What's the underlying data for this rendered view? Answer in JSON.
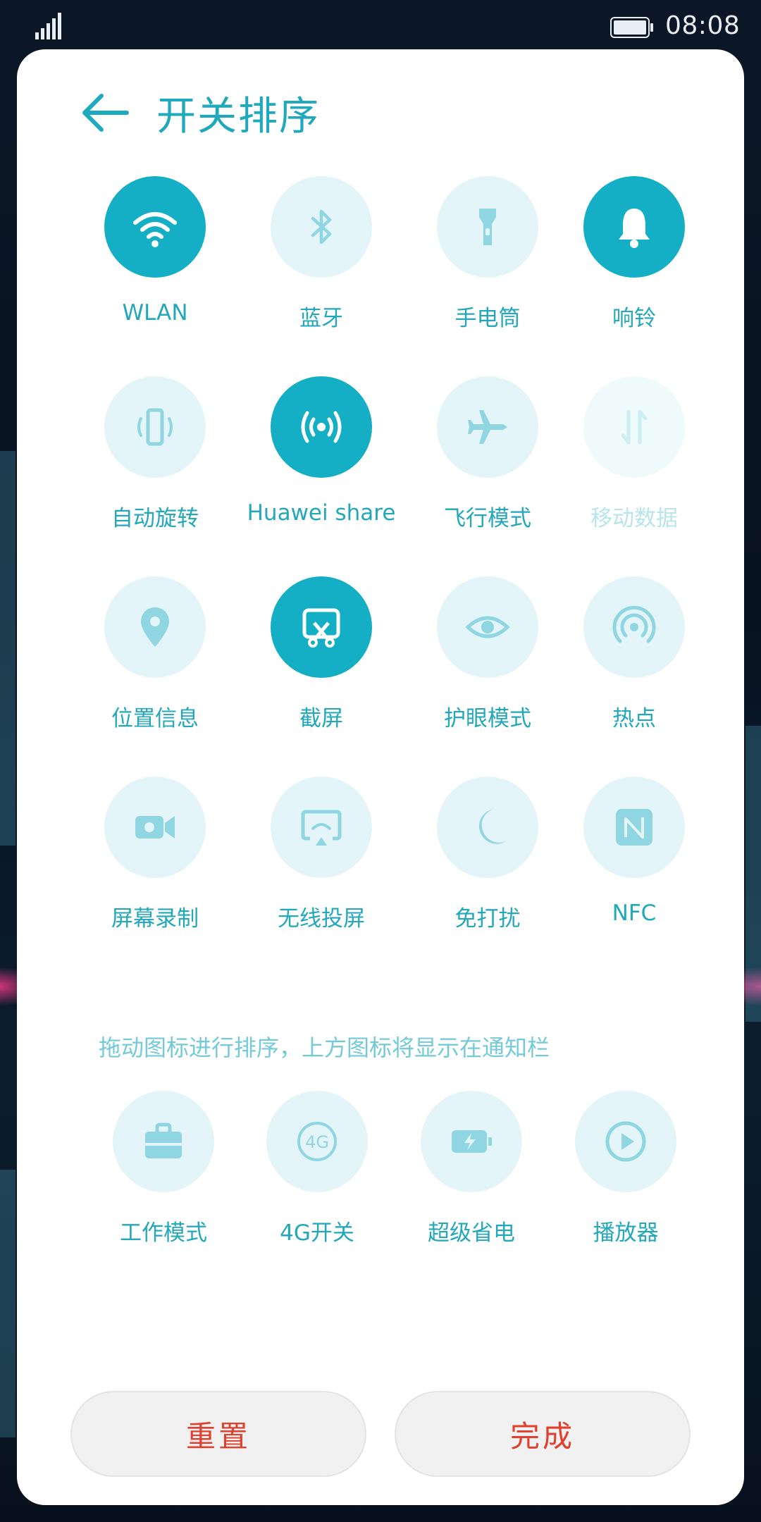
{
  "status_bar": {
    "time": "08:08"
  },
  "header": {
    "title": "开关排序"
  },
  "active_switches": [
    {
      "label": "WLAN",
      "icon": "wifi-icon",
      "on": true
    },
    {
      "label": "蓝牙",
      "icon": "bluetooth-icon",
      "on": false
    },
    {
      "label": "手电筒",
      "icon": "flashlight-icon",
      "on": false
    },
    {
      "label": "响铃",
      "icon": "bell-icon",
      "on": true
    },
    {
      "label": "自动旋转",
      "icon": "auto-rotate-icon",
      "on": false
    },
    {
      "label": "Huawei share",
      "icon": "huawei-share-icon",
      "on": true
    },
    {
      "label": "飞行模式",
      "icon": "airplane-icon",
      "on": false
    },
    {
      "label": "移动数据",
      "icon": "mobile-data-icon",
      "on": false,
      "disabled": true
    },
    {
      "label": "位置信息",
      "icon": "location-icon",
      "on": false
    },
    {
      "label": "截屏",
      "icon": "screenshot-icon",
      "on": true
    },
    {
      "label": "护眼模式",
      "icon": "eye-icon",
      "on": false
    },
    {
      "label": "热点",
      "icon": "hotspot-icon",
      "on": false
    },
    {
      "label": "屏幕录制",
      "icon": "video-camera-icon",
      "on": false
    },
    {
      "label": "无线投屏",
      "icon": "wireless-projection-icon",
      "on": false
    },
    {
      "label": "免打扰",
      "icon": "moon-icon",
      "on": false
    },
    {
      "label": "NFC",
      "icon": "nfc-icon",
      "on": false
    }
  ],
  "hint": "拖动图标进行排序，上方图标将显示在通知栏",
  "inactive_switches": [
    {
      "label": "工作模式",
      "icon": "briefcase-icon"
    },
    {
      "label": "4G开关",
      "icon": "4g-icon"
    },
    {
      "label": "超级省电",
      "icon": "battery-saver-icon"
    },
    {
      "label": "播放器",
      "icon": "play-icon"
    }
  ],
  "buttons": {
    "reset": "重置",
    "done": "完成"
  },
  "colors": {
    "accent": "#14afc4",
    "tile_off": "#e3f5f8",
    "label": "#23a7ba",
    "button_text": "#e0402e"
  }
}
